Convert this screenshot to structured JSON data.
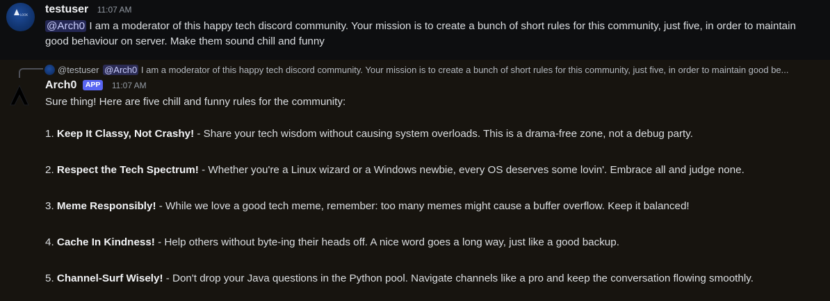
{
  "first_message": {
    "username": "testuser",
    "timestamp": "11:07 AM",
    "mention": "@Arch0",
    "text": "I am a moderator of this happy tech discord community. Your mission is to create a bunch of short rules for this community, just five, in order to maintain good behaviour on server. Make them sound chill and funny"
  },
  "reply_preview": {
    "username": "@testuser",
    "mention": "@Arch0",
    "text": "I am a moderator of this happy tech discord community. Your mission is to create a bunch of short rules for this community, just five, in order to maintain good be..."
  },
  "bot_message": {
    "username": "Arch0",
    "badge": "APP",
    "timestamp": "11:07 AM",
    "intro": "Sure thing! Here are five chill and funny rules for the community:",
    "rules": [
      {
        "num": "1.",
        "title": "Keep It Classy, Not Crashy!",
        "text": " - Share your tech wisdom without causing system overloads. This is a drama-free zone, not a debug party."
      },
      {
        "num": "2.",
        "title": "Respect the Tech Spectrum!",
        "text": " - Whether you're a Linux wizard or a Windows newbie, every OS deserves some lovin'. Embrace all and judge none."
      },
      {
        "num": "3.",
        "title": "Meme Responsibly!",
        "text": " - While we love a good tech meme, remember: too many memes might cause a buffer overflow. Keep it balanced!"
      },
      {
        "num": "4.",
        "title": "Cache In Kindness!",
        "text": " - Help others without byte-ing their heads off. A nice word goes a long way, just like a good backup."
      },
      {
        "num": "5.",
        "title": "Channel-Surf Wisely!",
        "text": " - Don't drop your Java questions in the Python pool. Navigate channels like a pro and keep the conversation flowing smoothly."
      }
    ]
  },
  "colors": {
    "mention_bg": "#3a4170",
    "app_badge": "#5865f2",
    "highlight_bg": "#17140f"
  },
  "icons": {
    "user_avatar": "user-avatar-icon",
    "bot_avatar": "arch-logo-icon"
  }
}
